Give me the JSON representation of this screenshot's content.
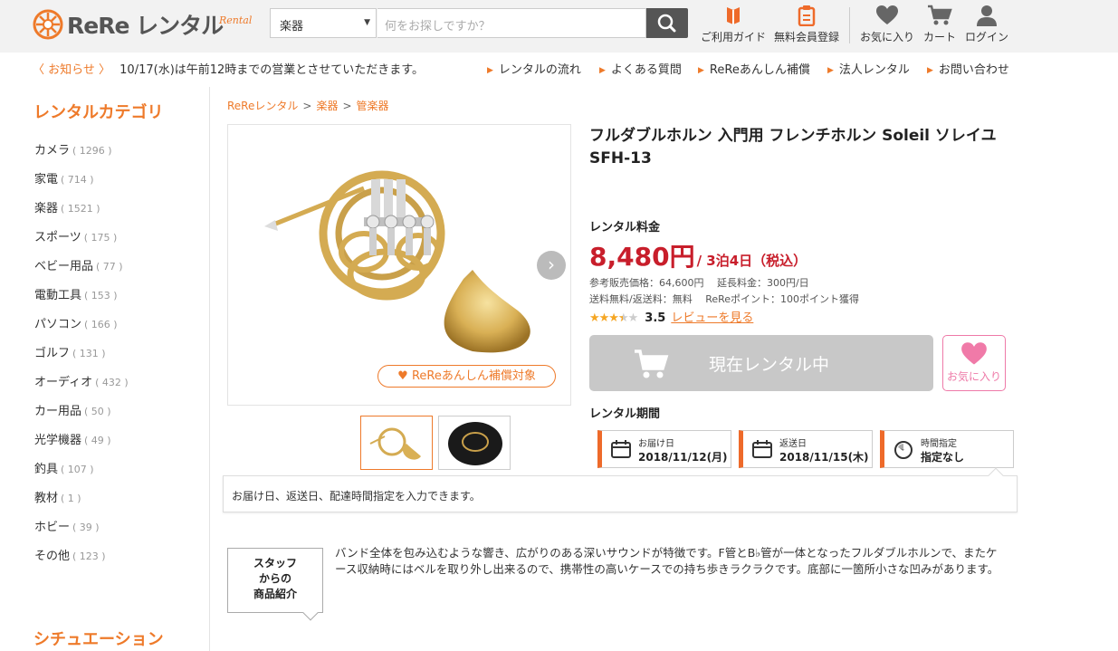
{
  "header": {
    "logo_text": "ReRe レンタル",
    "logo_sub": "Rental",
    "category_select": "楽器",
    "search_placeholder": "何をお探しですか？",
    "icons": {
      "guide": "ご利用ガイド",
      "register": "無料会員登録",
      "favorites": "お気に入り",
      "cart": "カート",
      "login": "ログイン"
    },
    "brand_color": "#ee7a2a"
  },
  "notice": {
    "label": "〈 お知らせ 〉",
    "text": "10/17(水)は午前12時までの営業とさせていただきます。"
  },
  "top_links": [
    "レンタルの流れ",
    "よくある質問",
    "ReReあんしん補償",
    "法人レンタル",
    "お問い合わせ"
  ],
  "sidebar": {
    "title": "レンタルカテゴリ",
    "items": [
      {
        "label": "カメラ",
        "count": "( 1296 )"
      },
      {
        "label": "家電",
        "count": "( 714 )"
      },
      {
        "label": "楽器",
        "count": "( 1521 )"
      },
      {
        "label": "スポーツ",
        "count": "( 175 )"
      },
      {
        "label": "ベビー用品",
        "count": "( 77 )"
      },
      {
        "label": "電動工具",
        "count": "( 153 )"
      },
      {
        "label": "パソコン",
        "count": "( 166 )"
      },
      {
        "label": "ゴルフ",
        "count": "( 131 )"
      },
      {
        "label": "オーディオ",
        "count": "( 432 )"
      },
      {
        "label": "カー用品",
        "count": "( 50 )"
      },
      {
        "label": "光学機器",
        "count": "( 49 )"
      },
      {
        "label": "釣具",
        "count": "( 107 )"
      },
      {
        "label": "教材",
        "count": "( 1 )"
      },
      {
        "label": "ホビー",
        "count": "( 39 )"
      },
      {
        "label": "その他",
        "count": "( 123 )"
      }
    ],
    "section2_title": "シチュエーション"
  },
  "breadcrumb": [
    "ReReレンタル",
    "楽器",
    "管楽器"
  ],
  "product": {
    "title": "フルダブルホルン 入門用 フレンチホルン Soleil ソレイユ SFH-13",
    "badge": "ReReあんしん補償対象",
    "fee_label": "レンタル料金",
    "price": "8,480円",
    "price_period": "/ 3泊4日（税込）",
    "ref_price": "参考販売価格：64,600円　 延長料金：300円/日",
    "shipping": "送料無料/返送料：無料　 ReReポイント：100ポイント獲得",
    "rating": 3.5,
    "rating_text": "3.5",
    "review_link": "レビューを見る",
    "cart_button": "現在レンタル中",
    "fav_button": "お気に入り",
    "period_label": "レンタル期間",
    "delivery": {
      "label": "お届け日",
      "value": "2018/11/12(月)"
    },
    "return": {
      "label": "返送日",
      "value": "2018/11/15(木)"
    },
    "time": {
      "label": "時間指定",
      "value": "指定なし"
    },
    "tip": "お届け日、返送日、配達時間指定を入力できます。",
    "price_color": "#c81e2b"
  },
  "staff": {
    "line1": "スタッフ",
    "line2": "からの",
    "line3": "商品紹介",
    "text": "バンド全体を包み込むような響き、広がりのある深いサウンドが特徴です。F管とB♭管が一体となったフルダブルホルンで、またケース収納時にはベルを取り外し出来るので、携帯性の高いケースでの持ち歩きラクラクです。底部に一箇所小さな凹みがあります。"
  }
}
